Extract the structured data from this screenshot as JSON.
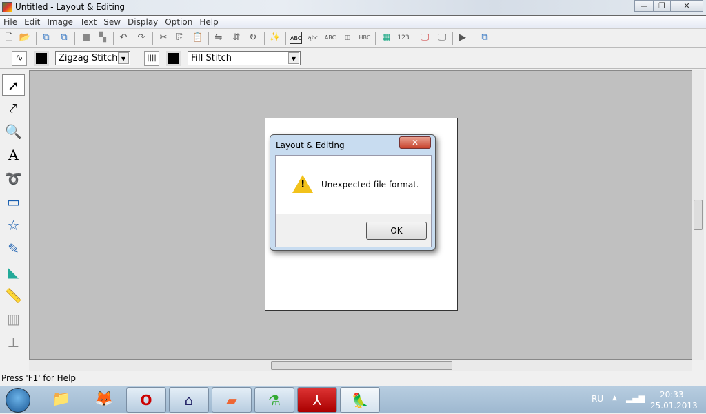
{
  "window": {
    "title": "Untitled - Layout & Editing",
    "minimize": "—",
    "restore": "❐",
    "close": "✕"
  },
  "menu": [
    "File",
    "Edit",
    "Image",
    "Text",
    "Sew",
    "Display",
    "Option",
    "Help"
  ],
  "toolbar1": [
    "new-file",
    "open",
    "import",
    "export",
    "save",
    "save-as",
    "undo",
    "redo",
    "cut",
    "copy",
    "paste",
    "mirror",
    "flip",
    "rotate",
    "wizard",
    "text-abc",
    "text-arc",
    "text-vertical",
    "text-monogram",
    "text-hbc",
    "stitch-view",
    "numbers",
    "monitor-color",
    "monitor",
    "sew-send",
    "window"
  ],
  "toolbar2": {
    "outline_stitch": "Zigzag Stitch",
    "fill_stitch": "Fill Stitch"
  },
  "palette": [
    "select",
    "point-edit",
    "zoom",
    "text",
    "lasso",
    "rectangle",
    "star",
    "freehand",
    "ribbon",
    "ruler",
    "stitch",
    "stamp"
  ],
  "dialog": {
    "title": "Layout & Editing",
    "close": "✕",
    "message": "Unexpected file format.",
    "ok": "OK"
  },
  "status": "Press 'F1' for Help",
  "taskbar": {
    "language": "RU",
    "time": "20:33",
    "date": "25.01.2013",
    "apps": [
      "explorer",
      "firefox",
      "opera",
      "hp",
      "photo",
      "app-green",
      "acrobat",
      "embroidery-v7"
    ]
  }
}
